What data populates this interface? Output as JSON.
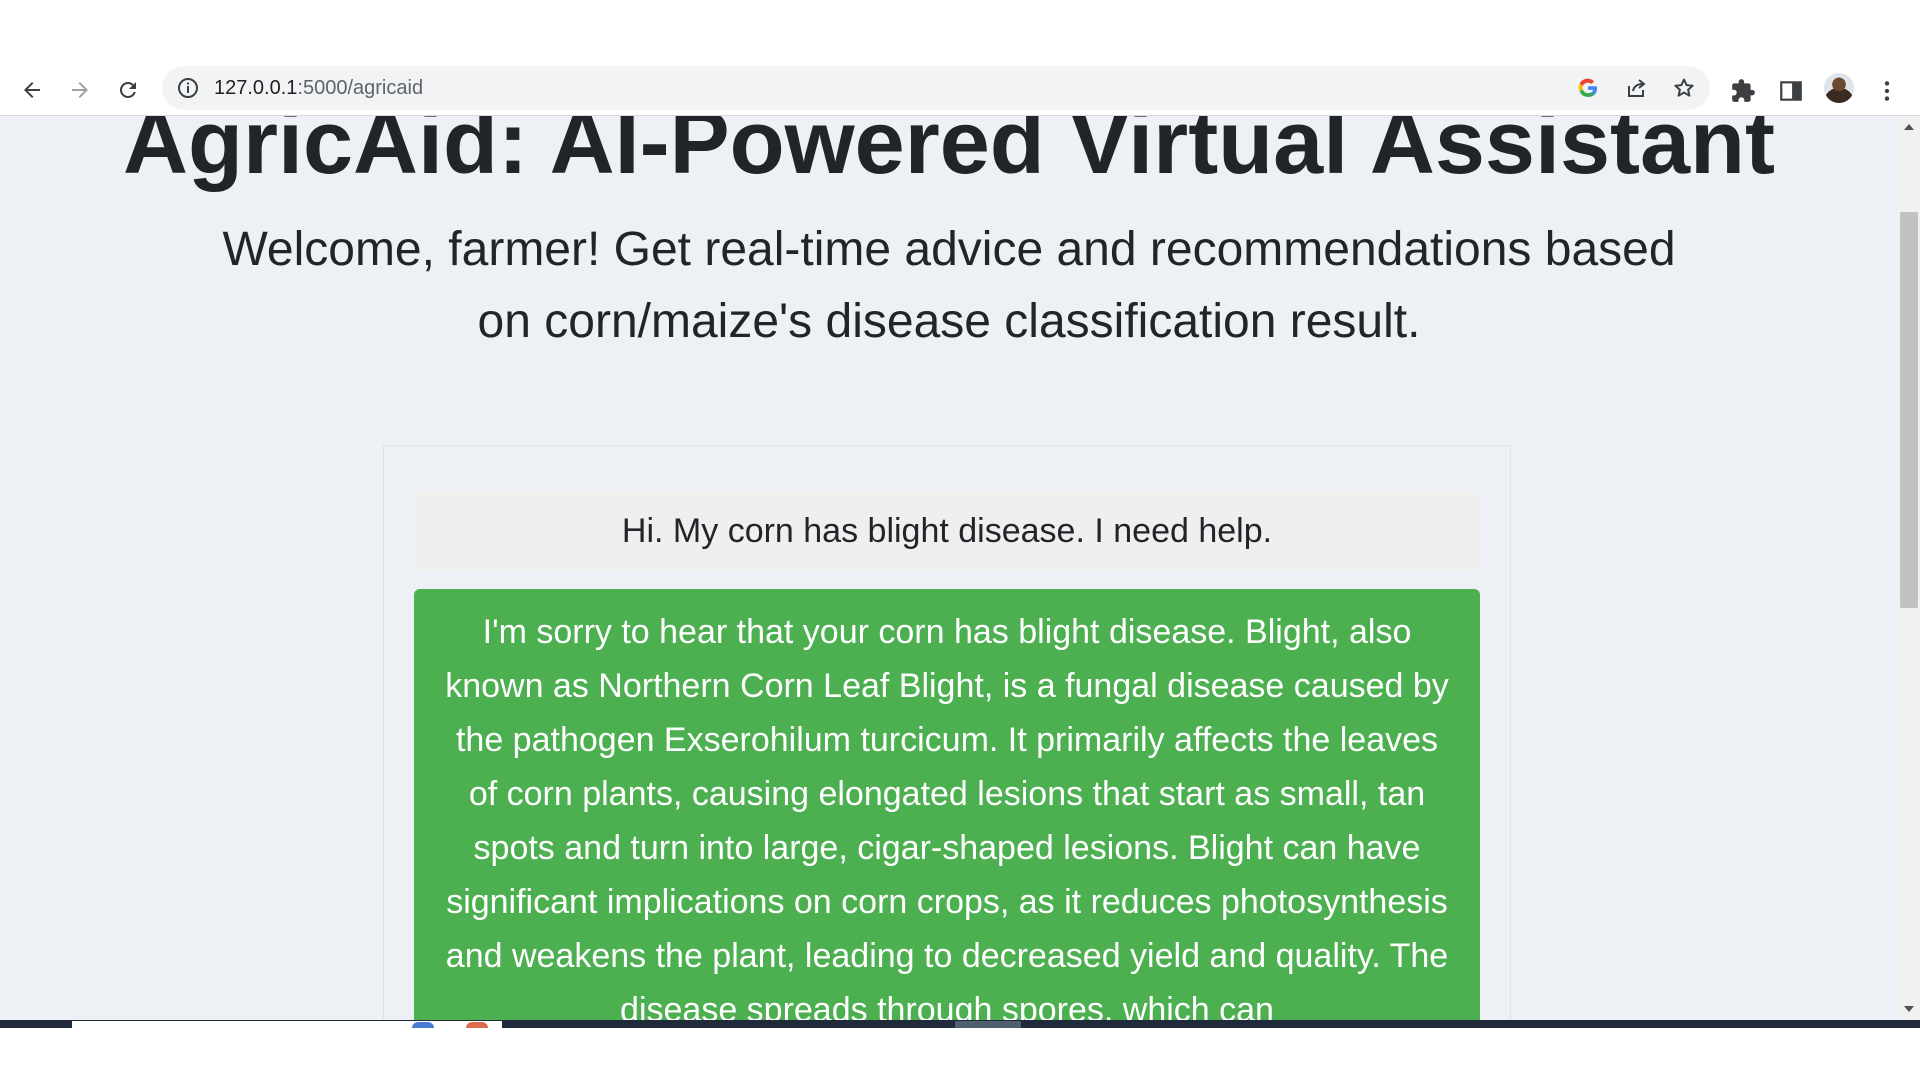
{
  "browser": {
    "url_host": "127.0.0.1",
    "url_path": ":5000/agricaid",
    "icons": {
      "back": "arrow-left-icon",
      "forward": "arrow-right-icon",
      "reload": "reload-icon",
      "site_info": "info-icon",
      "google": "google-icon",
      "share": "share-icon",
      "bookmark": "star-icon",
      "extensions": "puzzle-icon",
      "side_panel": "side-panel-icon",
      "profile": "avatar",
      "menu": "kebab-menu-icon"
    }
  },
  "page": {
    "title": "AgricAid: AI-Powered Virtual Assistant",
    "lead": "Welcome, farmer! Get real-time advice and recommendations based on corn/maize's disease classification result."
  },
  "chat": {
    "messages": [
      {
        "role": "user",
        "text": "Hi. My corn has blight disease. I need help."
      },
      {
        "role": "assistant",
        "text": "I'm sorry to hear that your corn has blight disease. Blight, also known as Northern Corn Leaf Blight, is a fungal disease caused by the pathogen Exserohilum turcicum. It primarily affects the leaves of corn plants, causing elongated lesions that start as small, tan spots and turn into large, cigar-shaped lesions. Blight can have significant implications on corn crops, as it reduces photosynthesis and weakens the plant, leading to decreased yield and quality. The disease spreads through spores, which can"
      }
    ]
  },
  "colors": {
    "page_bg": "#edf1f5",
    "user_bubble": "#efefef",
    "assistant_bubble": "#4caf50",
    "title_text": "#212529"
  }
}
